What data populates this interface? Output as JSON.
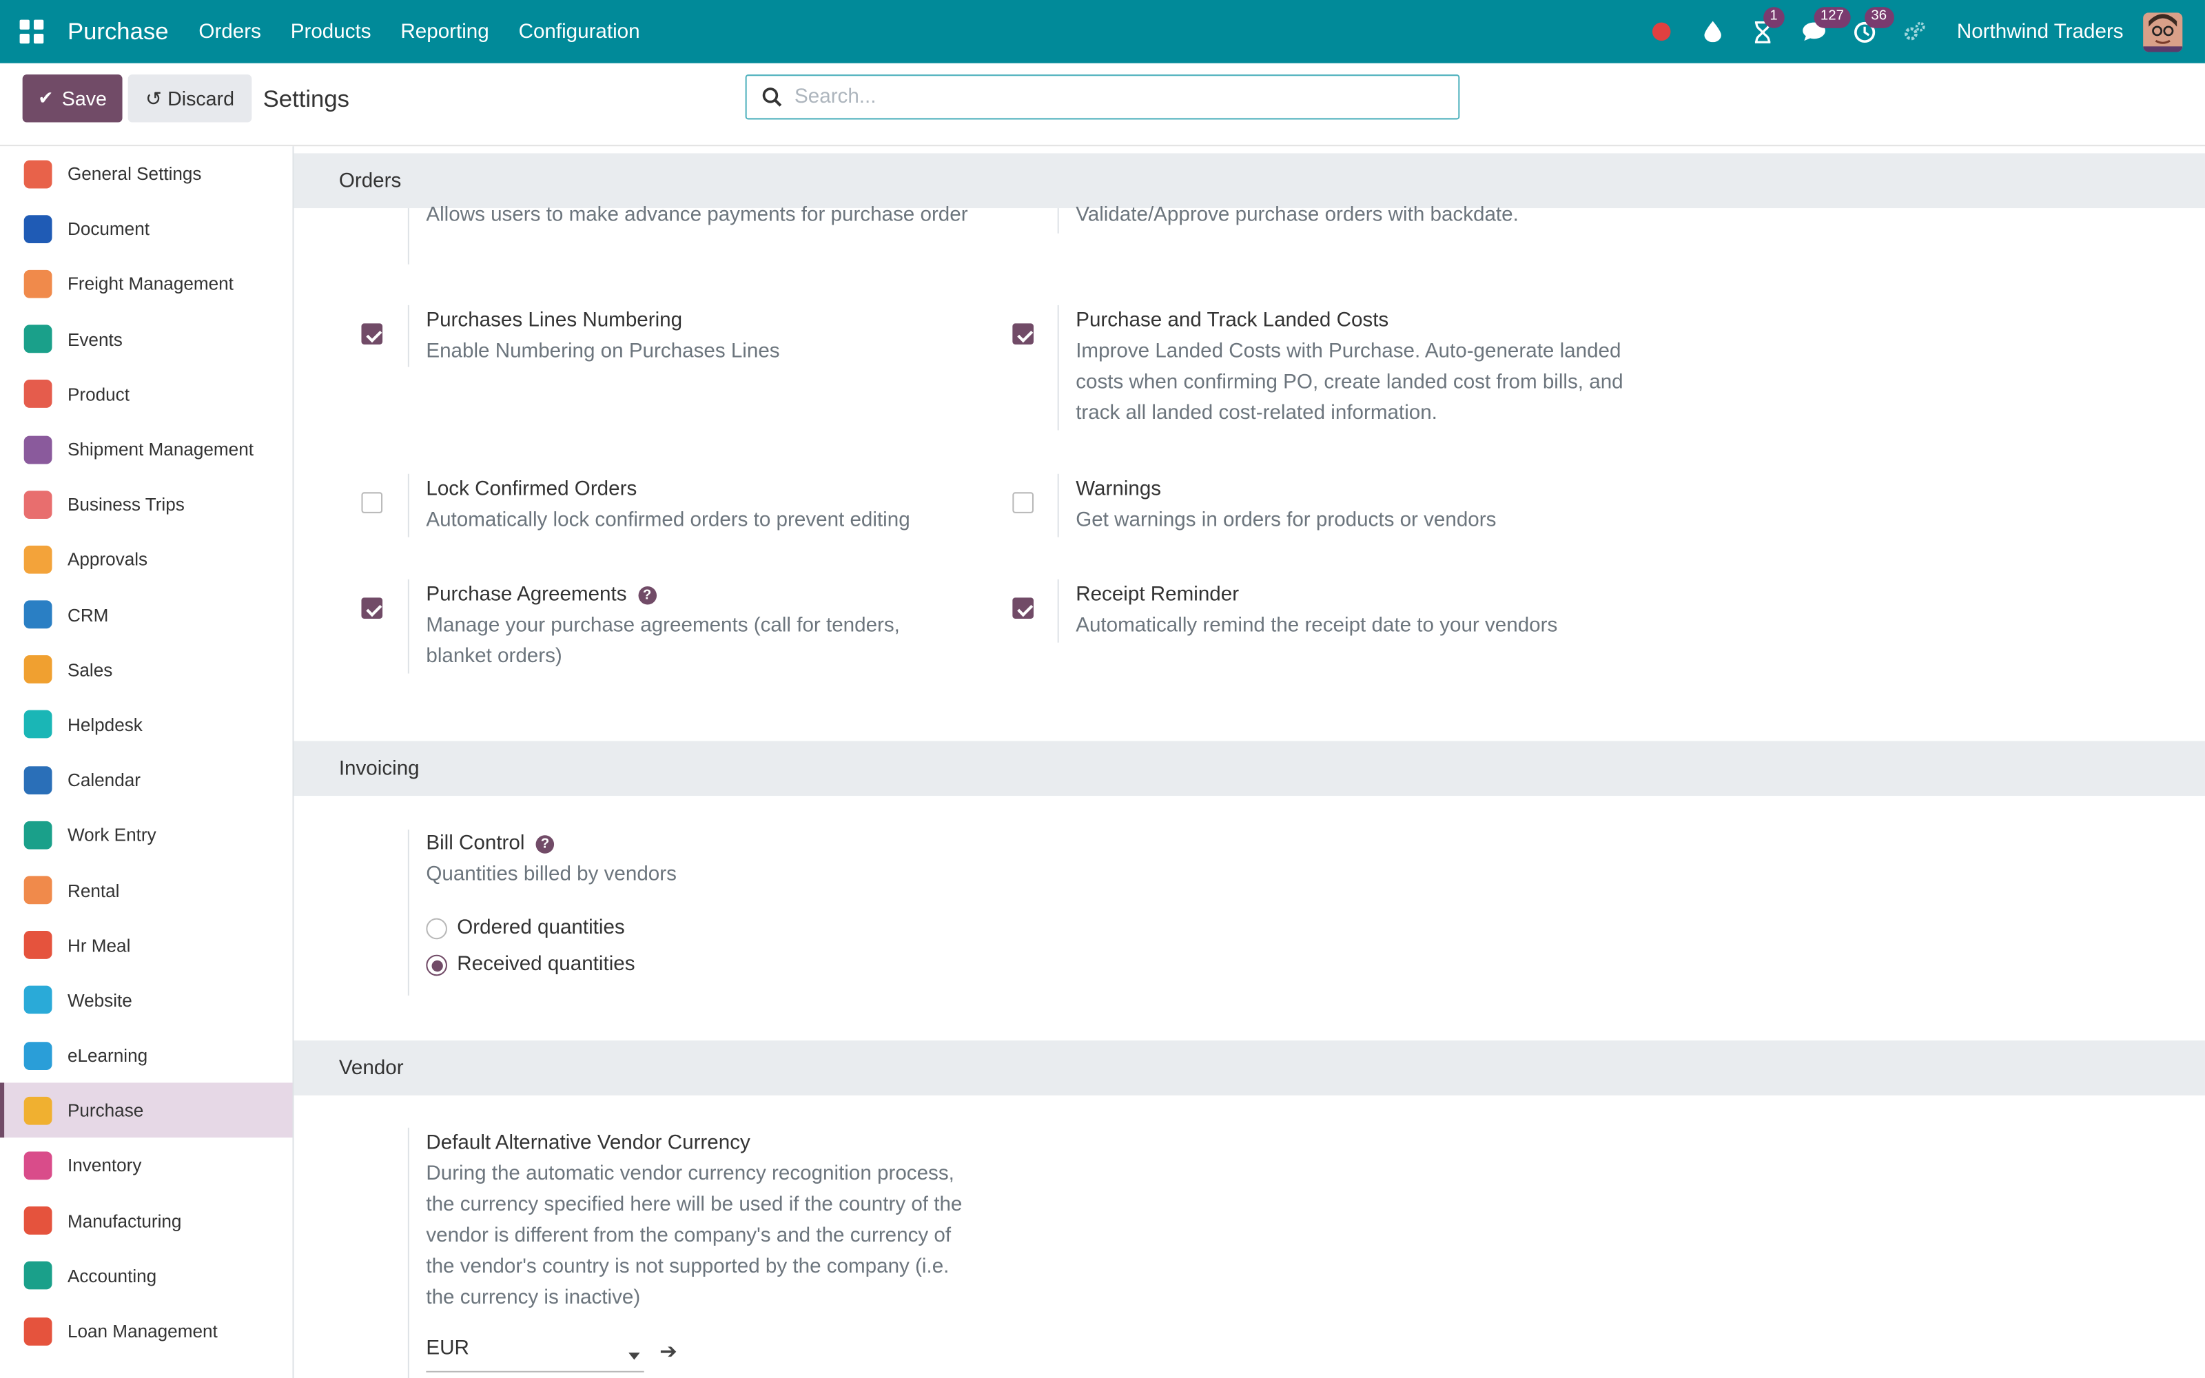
{
  "navbar": {
    "app_name": "Purchase",
    "menu": [
      "Orders",
      "Products",
      "Reporting",
      "Configuration"
    ],
    "badges": {
      "activities": "1",
      "messages": "127",
      "timer": "36"
    },
    "company": "Northwind Traders",
    "icons": [
      "record-dot-icon",
      "drop-icon",
      "hourglass-icon",
      "chat-icon",
      "clock-icon",
      "cogs-icon"
    ]
  },
  "control_panel": {
    "save_label": "Save",
    "discard_label": "Discard",
    "title": "Settings",
    "search_placeholder": "Search..."
  },
  "sidebar": {
    "items": [
      {
        "label": "General Settings",
        "color": "#e8624a"
      },
      {
        "label": "Document",
        "color": "#1f5bb5"
      },
      {
        "label": "Freight Management",
        "color": "#f08a4b"
      },
      {
        "label": "Events",
        "color": "#1aa08a"
      },
      {
        "label": "Product",
        "color": "#e55c4c"
      },
      {
        "label": "Shipment Management",
        "color": "#8a5a9c"
      },
      {
        "label": "Business Trips",
        "color": "#e86e6e"
      },
      {
        "label": "Approvals",
        "color": "#f3a33a"
      },
      {
        "label": "CRM",
        "color": "#2a7fc4"
      },
      {
        "label": "Sales",
        "color": "#f0a030"
      },
      {
        "label": "Helpdesk",
        "color": "#1ab6b6"
      },
      {
        "label": "Calendar",
        "color": "#2a6fb8"
      },
      {
        "label": "Work Entry",
        "color": "#1aa08a"
      },
      {
        "label": "Rental",
        "color": "#f08a4b"
      },
      {
        "label": "Hr Meal",
        "color": "#e5533d"
      },
      {
        "label": "Website",
        "color": "#2aaad8"
      },
      {
        "label": "eLearning",
        "color": "#2a9ed8"
      },
      {
        "label": "Purchase",
        "color": "#f0b030"
      },
      {
        "label": "Inventory",
        "color": "#d94c8a"
      },
      {
        "label": "Manufacturing",
        "color": "#e5533d"
      },
      {
        "label": "Accounting",
        "color": "#1aa08a"
      },
      {
        "label": "Loan Management",
        "color": "#e5533d"
      }
    ],
    "active_index": 17
  },
  "orders": {
    "title": "Orders",
    "partial_left_desc": "Allows users to make advance payments for purchase order",
    "partial_right_desc": "Validate/Approve purchase orders with backdate.",
    "settings": [
      {
        "title": "Purchases Lines Numbering",
        "desc": "Enable Numbering on Purchases Lines",
        "checked": true
      },
      {
        "title": "Purchase and Track Landed Costs",
        "desc": "Improve Landed Costs with Purchase. Auto-generate landed costs when confirming PO, create landed cost from bills, and track all landed cost-related information.",
        "checked": true
      },
      {
        "title": "Lock Confirmed Orders",
        "desc": "Automatically lock confirmed orders to prevent editing",
        "checked": false
      },
      {
        "title": "Warnings",
        "desc": "Get warnings in orders for products or vendors",
        "checked": false
      },
      {
        "title": "Purchase Agreements",
        "desc": "Manage your purchase agreements (call for tenders, blanket orders)",
        "checked": true,
        "help": "?"
      },
      {
        "title": "Receipt Reminder",
        "desc": "Automatically remind the receipt date to your vendors",
        "checked": true
      }
    ]
  },
  "invoicing": {
    "title": "Invoicing",
    "bill_control": {
      "title": "Bill Control",
      "help": "?",
      "desc": "Quantities billed by vendors",
      "options": [
        {
          "label": "Ordered quantities",
          "selected": false
        },
        {
          "label": "Received quantities",
          "selected": true
        }
      ]
    }
  },
  "vendor": {
    "title": "Vendor",
    "currency": {
      "title": "Default Alternative Vendor Currency",
      "desc": "During the automatic vendor currency recognition process, the currency specified here will be used if the country of the vendor is different from the company's and the currency of the vendor's country is not supported by the company (i.e. the currency is inactive)",
      "value": "EUR",
      "link_arrow": "➔"
    }
  },
  "colors": {
    "navbar": "#018a99",
    "primary": "#714b67"
  }
}
